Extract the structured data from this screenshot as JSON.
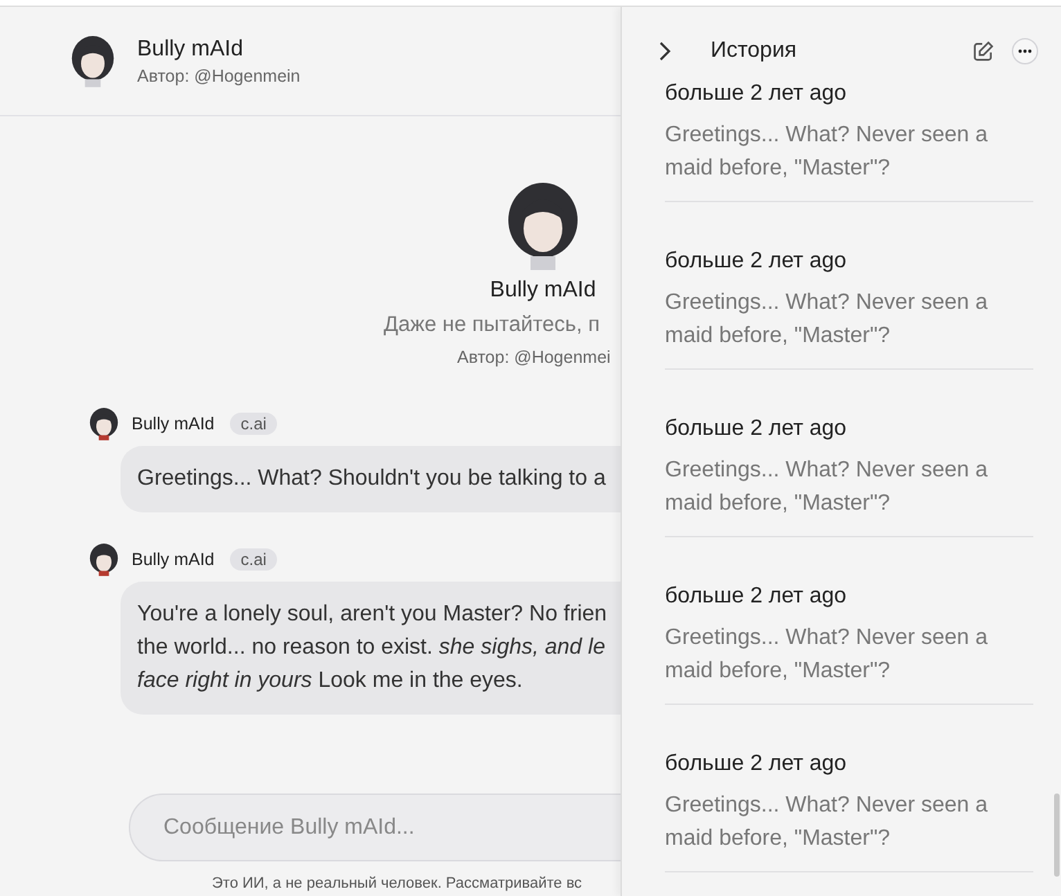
{
  "chat_header": {
    "name": "Bully mAId",
    "author": "Автор: @Hogenmein"
  },
  "character_intro": {
    "name": "Bully mAId",
    "tagline": "Даже не пытайтесь, п",
    "author": "Автор: @Hogenmei"
  },
  "messages": [
    {
      "sender": "Bully mAId",
      "badge": "c.ai",
      "lines": [
        "Greetings... What? Shouldn't you be talking to a"
      ]
    },
    {
      "sender": "Bully mAId",
      "badge": "c.ai",
      "lines": [
        "You're a lonely soul, aren't you Master? No frien",
        "the world... no reason to exist. *she sighs, and le*",
        "*face right in yours* Look me in the eyes."
      ]
    }
  ],
  "composer": {
    "placeholder": "Сообщение Bully mAId..."
  },
  "disclaimer": "Это ИИ, а не реальный человек. Рассматривайте вс",
  "history_panel": {
    "title": "История",
    "items": [
      {
        "time": "больше 2 лет ago",
        "preview": "Greetings... What? Never seen a maid before, \"Master\"?"
      },
      {
        "time": "больше 2 лет ago",
        "preview": "Greetings... What? Never seen a maid before, \"Master\"?"
      },
      {
        "time": "больше 2 лет ago",
        "preview": "Greetings... What? Never seen a maid before, \"Master\"?"
      },
      {
        "time": "больше 2 лет ago",
        "preview": "Greetings... What? Never seen a maid before, \"Master\"?"
      },
      {
        "time": "больше 2 лет ago",
        "preview": "Greetings... What? Never seen a maid before, \"Master\"?"
      }
    ]
  }
}
